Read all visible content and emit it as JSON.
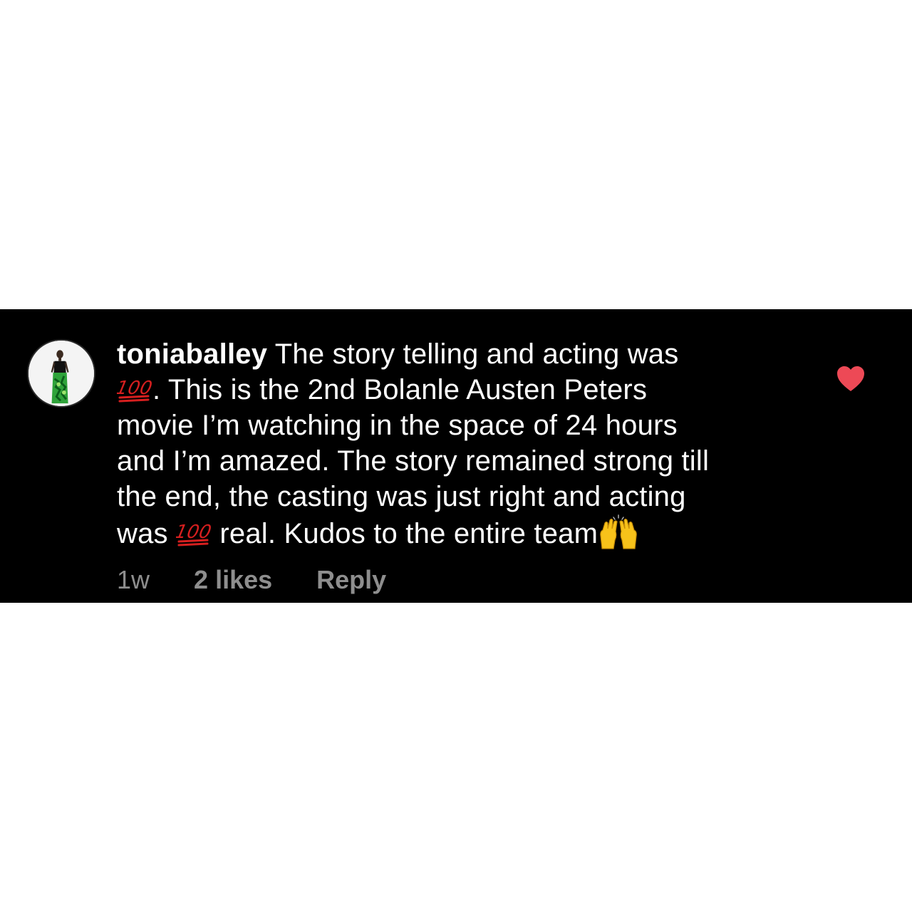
{
  "comment": {
    "username": "toniaballey",
    "lines": [
      " The story telling and acting was",
      ". This is the 2nd Bolanle Austen Peters",
      "movie I’m watching in the space of 24 hours",
      "and I’m amazed. The story remained strong till",
      "the end, the casting was just right and acting",
      "was",
      " real. Kudos to the entire team"
    ],
    "emojis": {
      "hundred": "hundred-points-emoji",
      "raised_hands": "raising-hands-emoji"
    },
    "liked": true
  },
  "meta": {
    "timestamp": "1w",
    "likes": "2 likes",
    "reply_label": "Reply"
  },
  "colors": {
    "panel_background": "#000000",
    "text": "#ffffff",
    "meta_text": "#8e8e8e",
    "heart": "#ed4956"
  },
  "icons": {
    "avatar": "avatar-photo",
    "like": "heart-icon"
  }
}
